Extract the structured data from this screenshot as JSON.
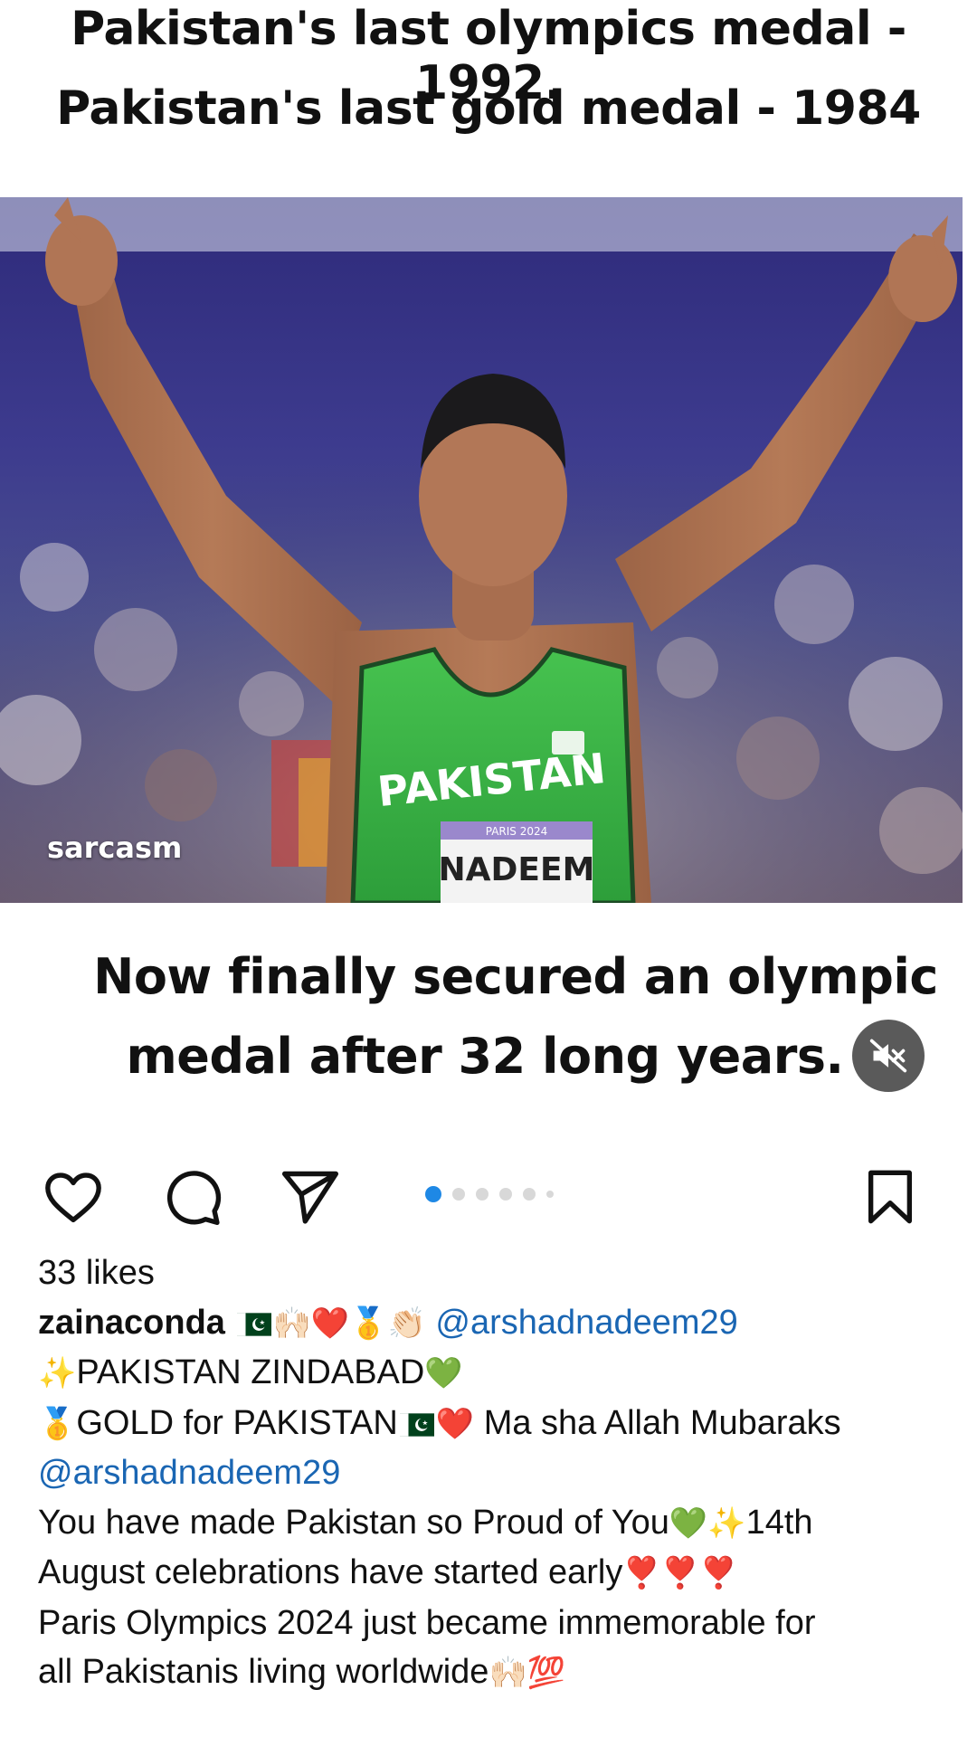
{
  "media": {
    "title_line1": "Pakistan's last olympics medal - 1992.",
    "title_line2": "Pakistan's last gold medal - 1984",
    "watermark": "sarcasm",
    "jersey_text": "PAKISTAN",
    "bib_event": "PARIS 2024",
    "bib_name": "NADEEM",
    "caption_line1": "Now finally secured an olympic",
    "caption_line2": "medal after 32 long years.",
    "mute_icon": "speaker-muted-icon"
  },
  "actions": {
    "like_icon": "heart-icon",
    "comment_icon": "comment-bubble-icon",
    "share_icon": "paper-plane-icon",
    "save_icon": "bookmark-icon",
    "carousel_total": 6,
    "carousel_active": 1
  },
  "post": {
    "likes": "33 likes",
    "username": "zainaconda",
    "line1_emojis": "🙌🏻❤️🥇👏🏻",
    "mention1": "@arshadnadeem29",
    "line2_prefix": "✨",
    "line2_text": "PAKISTAN ZINDABAD",
    "line2_suffix": "💚",
    "line3_prefix": "🥇",
    "line3_text": "GOLD for PAKISTAN",
    "line3_heart": "❤️",
    "line3_rest": " Ma sha Allah Mubaraks",
    "mention2": "@arshadnadeem29",
    "line5_text": "You have made Pakistan so Proud of You",
    "line5_emojis": "💚✨",
    "line5_rest": "14th",
    "line6_text": "August celebrations have started early",
    "line6_emojis": "❣️❣️❣️",
    "line7_text": "Paris Olympics 2024 just became immemorable for",
    "line8_text": "all Pakistanis living worldwide",
    "line8_emojis": "🙌🏻💯"
  },
  "colors": {
    "mention": "#1a66b3",
    "carousel_active": "#1e88e5",
    "jersey_green": "#3bb84a"
  }
}
